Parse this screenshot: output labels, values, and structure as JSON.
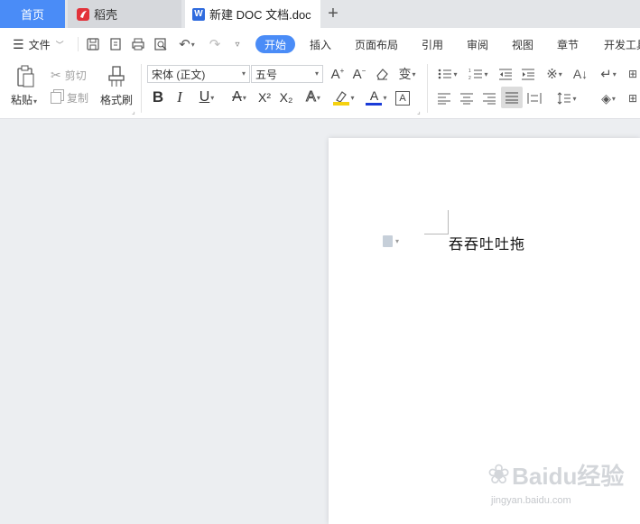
{
  "tabs": {
    "home": "首页",
    "docer": "稻壳",
    "document": "新建 DOC 文档.doc",
    "add": "+"
  },
  "menu": {
    "file": "文件",
    "start": "开始",
    "insert": "插入",
    "page_layout": "页面布局",
    "reference": "引用",
    "review": "审阅",
    "view": "视图",
    "chapter": "章节",
    "developer": "开发工具"
  },
  "ribbon": {
    "paste": "粘贴",
    "cut": "剪切",
    "copy": "复制",
    "format_painter": "格式刷",
    "font_name": "宋体 (正文)",
    "font_size": "五号",
    "bold": "B",
    "italic": "I",
    "underline": "U",
    "superscript": "X²",
    "subscript": "X₂",
    "font_color_glyph": "A",
    "pinyin_glyph": "wén"
  },
  "document": {
    "body_text": "吞吞吐吐拖"
  },
  "watermark": {
    "brand": "Baidu经验",
    "url": "jingyan.baidu.com"
  },
  "colors": {
    "accent": "#4a8cf7",
    "docer_red": "#e2323a",
    "highlight_yellow": "#f5d10f",
    "font_color_red": "#d0281f",
    "font_color_blue": "#1a3bd8",
    "canvas_bg": "#eceef1"
  }
}
